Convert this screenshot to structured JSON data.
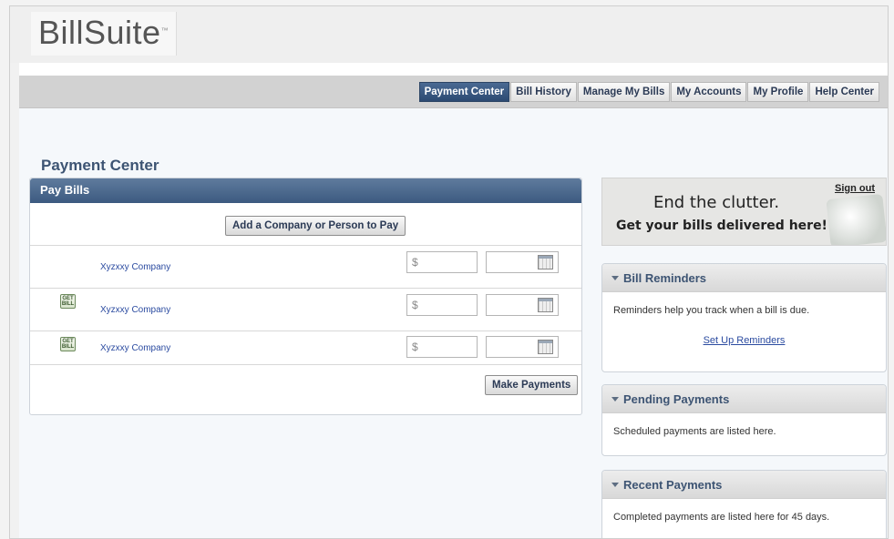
{
  "brand": {
    "logo_text": "BillSuite",
    "logo_mark": "™"
  },
  "nav": {
    "tabs": [
      {
        "label": "Payment Center",
        "active": true
      },
      {
        "label": "Bill History",
        "active": false
      },
      {
        "label": "Manage My Bills",
        "active": false
      },
      {
        "label": "My Accounts",
        "active": false
      },
      {
        "label": "My Profile",
        "active": false
      },
      {
        "label": "Help Center",
        "active": false
      }
    ]
  },
  "page": {
    "title": "Payment Center"
  },
  "pay_bills": {
    "header": "Pay Bills",
    "add_button": "Add a Company or Person to Pay",
    "rows": [
      {
        "company": "Xyzxxy Company",
        "amount_placeholder": "$",
        "date_value": "",
        "has_getbill": false
      },
      {
        "company": "Xyzxxy Company",
        "amount_placeholder": "$",
        "date_value": "",
        "has_getbill": true
      },
      {
        "company": "Xyzxxy Company",
        "amount_placeholder": "$",
        "date_value": "",
        "has_getbill": true
      }
    ],
    "getbill_label": "GET BILL",
    "make_payments_button": "Make Payments"
  },
  "banner": {
    "line1": "End the clutter.",
    "line2": "Get your bills delivered here!",
    "sign_out": "Sign out"
  },
  "bill_reminders": {
    "title": "Bill Reminders",
    "text": "Reminders help you track when a bill is due.",
    "link": "Set Up Reminders"
  },
  "pending_payments": {
    "title": "Pending Payments",
    "text": "Scheduled payments are listed here."
  },
  "recent_payments": {
    "title": "Recent Payments",
    "text": "Completed payments are listed here for 45 days."
  }
}
